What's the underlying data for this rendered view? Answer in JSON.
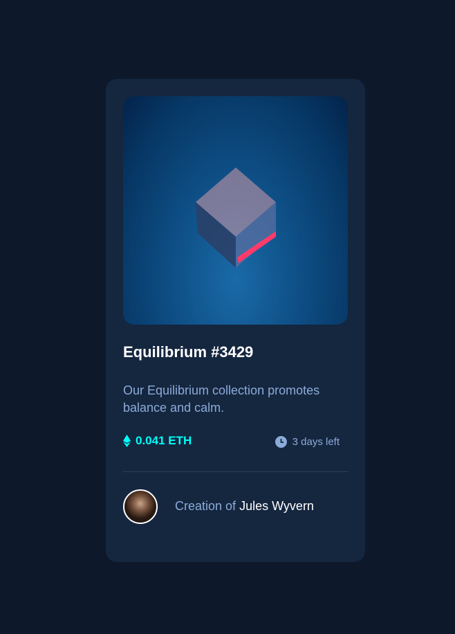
{
  "card": {
    "image_alt": "Equilibrium",
    "title": "Equilibrium #3429",
    "description": "Our Equilibrium collection promotes balance and calm.",
    "price": "0.041 ETH",
    "time_left": "3 days left",
    "creator_prefix": "Creation of",
    "creator_name": "Jules Wyvern",
    "icons": {
      "price": "ethereum-icon",
      "time": "clock-icon"
    },
    "colors": {
      "accent": "#00fff8",
      "muted": "#8bacd9",
      "card": "#15263f",
      "background": "#0d192b"
    }
  }
}
